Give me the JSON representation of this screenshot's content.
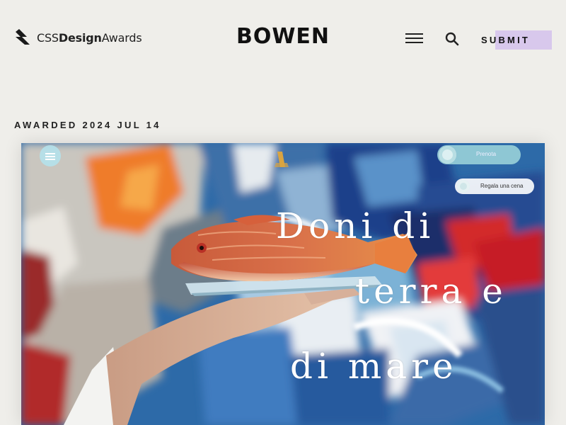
{
  "header": {
    "logo_text_light": "CSS",
    "logo_text_bold": "Design",
    "logo_text_end": "Awards",
    "brand": "BOWEN",
    "submit_label": "SUBMIT"
  },
  "award": {
    "label": "AWARDED 2024 JUL 14"
  },
  "screenshot": {
    "headline_lines": [
      "Doni di",
      "terra e",
      "di mare"
    ],
    "prenota_label": "Prenota",
    "regala_label": "Regala una cena"
  },
  "colors": {
    "page_bg": "#efeeea",
    "submit_highlight": "#d8c8ec",
    "text": "#111111"
  },
  "icons": [
    "cssda-logo-icon",
    "menu-icon",
    "search-icon",
    "site-menu-icon",
    "site-logo-icon"
  ]
}
